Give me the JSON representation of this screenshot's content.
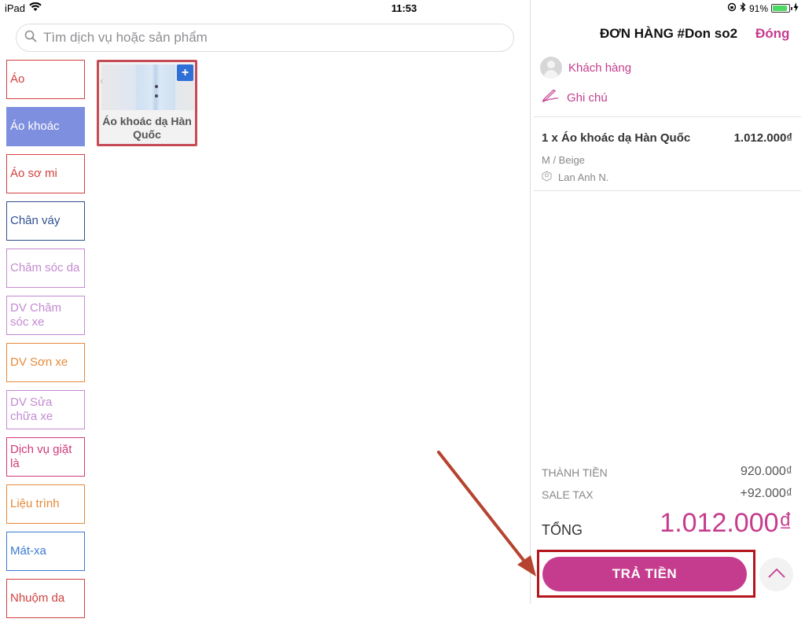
{
  "status_bar": {
    "device": "iPad",
    "time": "11:53",
    "battery": "91%",
    "battery_level": 0.91
  },
  "search": {
    "placeholder": "Tìm dịch vụ hoặc sản phẩm"
  },
  "categories": [
    {
      "label": "Áo",
      "color": "#d2403f",
      "selected": false
    },
    {
      "label": "Áo khoác",
      "color": "#ffffff",
      "bg": "#7f8fdf",
      "selected": true
    },
    {
      "label": "Áo sơ mi",
      "color": "#d2403f",
      "selected": false
    },
    {
      "label": "Chân váy",
      "color": "#2f4f8f",
      "selected": false
    },
    {
      "label": "Chăm sóc da",
      "color": "#c48ad2",
      "selected": false
    },
    {
      "label": "DV Chăm sóc xe",
      "color": "#c48ad2",
      "selected": false
    },
    {
      "label": "DV Sơn xe",
      "color": "#e58a3a",
      "selected": false
    },
    {
      "label": "DV Sửa chữa xe",
      "color": "#c48ad2",
      "selected": false
    },
    {
      "label": "Dịch vụ giặt là",
      "color": "#d23a7a",
      "selected": false
    },
    {
      "label": "Liệu trình",
      "color": "#e58a3a",
      "selected": false
    },
    {
      "label": "Mát-xa",
      "color": "#3a7ad2",
      "selected": false
    },
    {
      "label": "Nhuộm da",
      "color": "#d2403f",
      "selected": false
    }
  ],
  "product": {
    "name": "Áo khoác dạ Hàn Quốc",
    "add_label": "+"
  },
  "order": {
    "title": "ĐƠN HÀNG #Don so2",
    "close_label": "Đóng",
    "customer_label": "Khách hàng",
    "note_label": "Ghi chú",
    "item": {
      "line": "1 x Áo khoác dạ Hàn Quốc",
      "price": "1.012.000₫",
      "variant": "M / Beige",
      "staff": "Lan Anh N."
    },
    "subtotal_label": "THÀNH TIỀN",
    "subtotal_value": "920.000₫",
    "tax_label": "SALE TAX",
    "tax_value": "+92.000₫",
    "total_label": "TỔNG",
    "total_value": "1.012.000₫",
    "pay_label": "TRẢ TIỀN"
  },
  "colors": {
    "accent": "#c53c8e",
    "highlight": "#b5161c",
    "annotation_arrow": "#b5432f"
  }
}
